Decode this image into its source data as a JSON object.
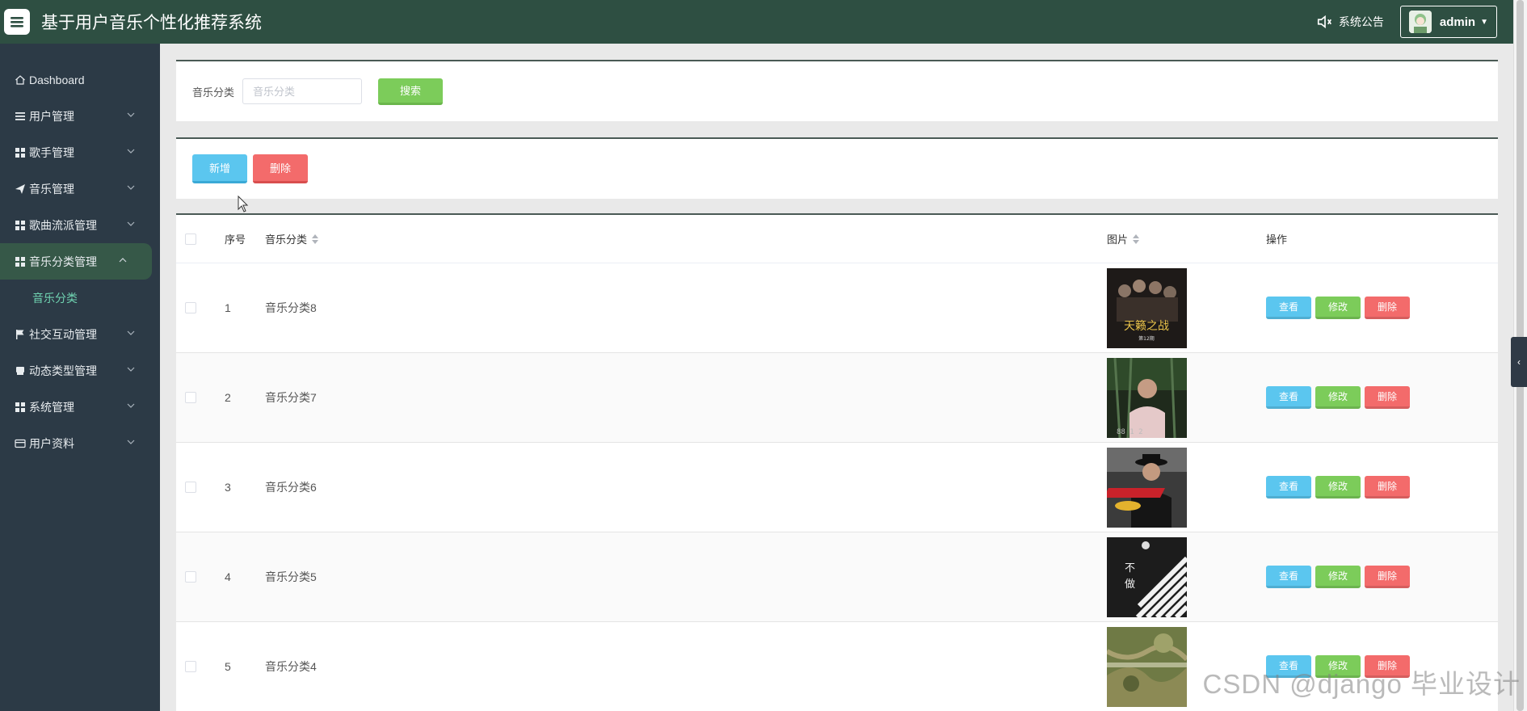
{
  "header": {
    "title": "基于用户音乐个性化推荐系统",
    "notice_label": "系统公告",
    "user_name": "admin"
  },
  "sidebar": {
    "items": [
      {
        "label": "Dashboard",
        "icon": "home-icon"
      },
      {
        "label": "用户管理",
        "icon": "list-icon"
      },
      {
        "label": "歌手管理",
        "icon": "grid-icon"
      },
      {
        "label": "音乐管理",
        "icon": "send-icon"
      },
      {
        "label": "歌曲流派管理",
        "icon": "grid-icon"
      },
      {
        "label": "音乐分类管理",
        "icon": "grid-icon"
      },
      {
        "label": "音乐分类",
        "icon": ""
      },
      {
        "label": "社交互动管理",
        "icon": "flag-icon"
      },
      {
        "label": "动态类型管理",
        "icon": "print-icon"
      },
      {
        "label": "系统管理",
        "icon": "grid-icon"
      },
      {
        "label": "用户资料",
        "icon": "card-icon"
      }
    ]
  },
  "search": {
    "label": "音乐分类",
    "placeholder": "音乐分类",
    "button": "搜索"
  },
  "actions": {
    "add": "新增",
    "delete": "删除"
  },
  "table": {
    "columns": [
      "序号",
      "音乐分类",
      "图片",
      "操作"
    ],
    "rows": [
      {
        "index": "1",
        "category": "音乐分类8",
        "image": "album-cover-group"
      },
      {
        "index": "2",
        "category": "音乐分类7",
        "image": "album-cover-man-forest"
      },
      {
        "index": "3",
        "category": "音乐分类6",
        "image": "album-cover-man-hat"
      },
      {
        "index": "4",
        "category": "音乐分类5",
        "image": "album-cover-stripes"
      },
      {
        "index": "5",
        "category": "音乐分类4",
        "image": "album-cover-landscape"
      }
    ],
    "ops": {
      "view": "查看",
      "edit": "修改",
      "delete": "删除"
    }
  },
  "watermark": "CSDN @django 毕业设计",
  "colors": {
    "header_bg": "#2e4f42",
    "sidebar_bg": "#2c3a46",
    "active_sub": "#6fd3b1",
    "btn_blue": "#5bc6ef",
    "btn_green": "#7ccc5a",
    "btn_red": "#f36b6b"
  }
}
